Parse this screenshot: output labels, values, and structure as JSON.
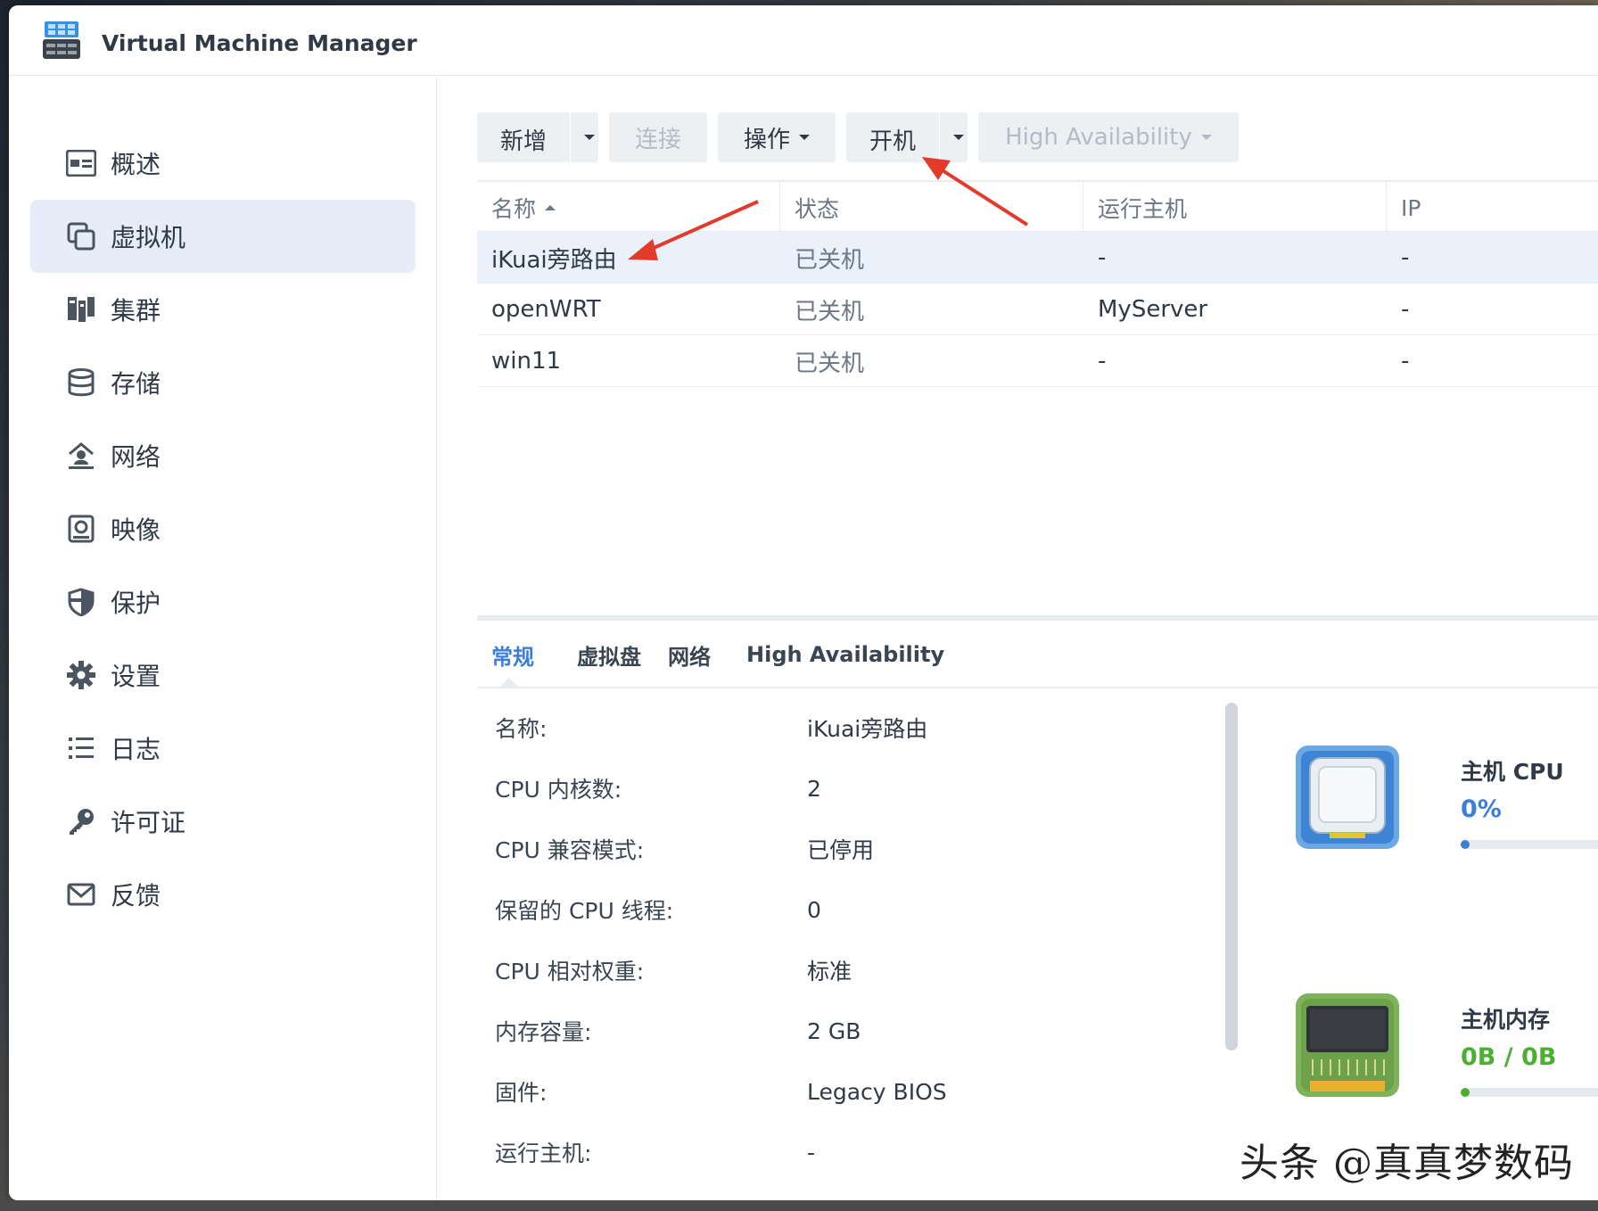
{
  "app": {
    "title": "Virtual Machine Manager"
  },
  "sidebar": {
    "items": [
      {
        "label": "概述",
        "icon": "overview-icon"
      },
      {
        "label": "虚拟机",
        "icon": "vm-icon",
        "active": true
      },
      {
        "label": "集群",
        "icon": "cluster-icon"
      },
      {
        "label": "存储",
        "icon": "storage-icon"
      },
      {
        "label": "网络",
        "icon": "network-icon"
      },
      {
        "label": "映像",
        "icon": "image-icon"
      },
      {
        "label": "保护",
        "icon": "shield-icon"
      },
      {
        "label": "设置",
        "icon": "gear-icon"
      },
      {
        "label": "日志",
        "icon": "log-icon"
      },
      {
        "label": "许可证",
        "icon": "key-icon"
      },
      {
        "label": "反馈",
        "icon": "mail-icon"
      }
    ]
  },
  "toolbar": {
    "add": "新增",
    "connect": "连接",
    "action": "操作",
    "power_on": "开机",
    "ha": "High Availability"
  },
  "grid": {
    "columns": [
      "名称",
      "状态",
      "运行主机",
      "IP"
    ],
    "rows": [
      {
        "name": "iKuai旁路由",
        "status": "已关机",
        "host": "-",
        "ip": "-",
        "selected": true
      },
      {
        "name": "openWRT",
        "status": "已关机",
        "host": "MyServer",
        "ip": "-"
      },
      {
        "name": "win11",
        "status": "已关机",
        "host": "-",
        "ip": "-"
      }
    ]
  },
  "tabs": [
    "常规",
    "虚拟盘",
    "网络",
    "High Availability"
  ],
  "details": [
    {
      "key": "名称:",
      "value": "iKuai旁路由"
    },
    {
      "key": "CPU 内核数:",
      "value": "2"
    },
    {
      "key": "CPU 兼容模式:",
      "value": "已停用"
    },
    {
      "key": "保留的 CPU 线程:",
      "value": "0"
    },
    {
      "key": "CPU 相对权重:",
      "value": "标准"
    },
    {
      "key": "内存容量:",
      "value": "2 GB"
    },
    {
      "key": "固件:",
      "value": "Legacy BIOS"
    },
    {
      "key": "运行主机:",
      "value": "-"
    }
  ],
  "metrics": {
    "cpu": {
      "label": "主机 CPU",
      "value": "0%",
      "percent": 0,
      "color": "#3b7fd9"
    },
    "memory": {
      "label": "主机内存",
      "value": "0B / 0B",
      "percent": 0,
      "color": "#4caf32"
    }
  },
  "watermark": "头条 @真真梦数码",
  "colors": {
    "accent": "#3b7fd9",
    "arrow": "#e23b2c"
  }
}
